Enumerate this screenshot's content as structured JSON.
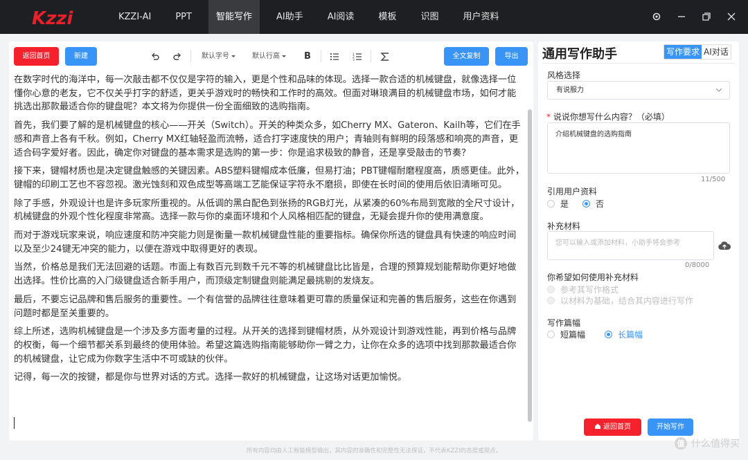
{
  "nav": {
    "items": [
      "KZZI-AI",
      "PPT",
      "智能写作",
      "AI助手",
      "AI阅读",
      "模板",
      "识图",
      "用户资料"
    ],
    "active_index": 2
  },
  "toolbar": {
    "back_label": "返回首页",
    "new_label": "新建",
    "font_size": "默认字号",
    "line_height": "默认行高",
    "bold": "B",
    "copy_all_label": "全文复制",
    "export_label": "导出"
  },
  "document": {
    "paragraphs": [
      "在数字时代的海洋中，每一次敲击都不仅仅是字符的输入，更是个性和品味的体现。选择一款合适的机械键盘，就像选择一位懂你心意的老友，它不仅关乎打字的舒适，更关乎游戏时的畅快和工作时的高效。但面对琳琅满目的机械键盘市场，如何才能挑选出那款最适合你的键盘呢？本文将为你提供一份全面细致的选购指南。",
      "首先，我们要了解的是机械键盘的核心——开关（Switch）。开关的种类众多，如Cherry MX、Gateron、Kailh等，它们在手感和声音上各有千秋。例如，Cherry MX红轴轻盈而流畅，适合打字速度快的用户；青轴则有鲜明的段落感和响亮的声音，更适合码字爱好者。因此，确定你对键盘的基本需求是选购的第一步：你是追求极致的静音，还是享受敲击的节奏？",
      "接下来，键帽材质也是决定键盘触感的关键因素。ABS塑料键帽成本低廉，但易打油；PBT键帽耐磨程度高，质感更佳。此外，键帽的印刷工艺也不容忽视。激光蚀刻和双色成型等高端工艺能保证字符永不磨损，即使在长时间的使用后依旧清晰可见。",
      "除了手感，外观设计也是许多玩家所重视的。从低调的黑白配色到张扬的RGB灯光，从紧凑的60%布局到宽敞的全尺寸设计，机械键盘的外观个性化程度非常高。选择一款与你的桌面环境和个人风格相匹配的键盘，无疑会提升你的使用满意度。",
      "而对于游戏玩家来说，响应速度和防冲突能力则是衡量一款机械键盘性能的重要指标。确保你所选的键盘具有快速的响应时间以及至少24键无冲突的能力，以便在游戏中取得更好的表现。",
      "当然，价格总是我们无法回避的话题。市面上有数百元到数千元不等的机械键盘比比皆是，合理的预算规划能帮助你更好地做出选择。性价比高的入门级键盘适合新手用户，而顶级定制键盘则能满足最挑剔的发烧友。",
      "最后，不要忘记品牌和售后服务的重要性。一个有信誉的品牌往往意味着更可靠的质量保证和完善的售后服务，这些在你遇到问题时都是至关重要的。",
      "综上所述，选购机械键盘是一个涉及多方面考量的过程。从开关的选择到键帽材质，从外观设计到游戏性能，再到价格与品牌的权衡，每一个细节都关系到最终的使用体验。希望这篇选购指南能够助你一臂之力，让你在众多的选项中找到那款最适合你的机械键盘，让它成为你数字生活中不可或缺的伙伴。",
      "记得，每一次的按键，都是你与世界对话的方式。选择一款好的机械键盘，让这场对话更加愉悦。"
    ]
  },
  "assistant": {
    "title": "通用写作助手",
    "tabs": [
      "写作要求",
      "AI对话"
    ],
    "active_tab": 0,
    "style_label": "风格选择",
    "style_value": "有说服力",
    "content_label_req": "*",
    "content_label": " 说说你想写什么内容？（必填）",
    "content_value": "介绍机械键盘的选购指南",
    "content_counter": "11/500",
    "ref_label": "引用用户资料",
    "ref_options": [
      "是",
      "否"
    ],
    "ref_selected": 1,
    "supp_label": "补充材料",
    "supp_placeholder": "您可以输入或添加材料，小助手将会参考",
    "supp_counter": "0/8000",
    "usage_label": "你希望如何使用补充材料",
    "usage_options": [
      "参考其写作格式",
      "以材料为基础，结合其内容进行写作"
    ],
    "length_label": "写作篇幅",
    "length_options": [
      "短篇幅",
      "长篇幅"
    ],
    "length_selected": 1,
    "back_label": "返回首页",
    "start_label": "开始写作"
  },
  "footer": "所有内容均由人工智能模型输出，其内容的准确性和完整性无法保证，不代表KZZI的态度或观点。",
  "watermark": "什么值得买",
  "colors": {
    "accent": "#3894f7",
    "danger": "#f5222d",
    "topbar": "#1e1f22"
  }
}
